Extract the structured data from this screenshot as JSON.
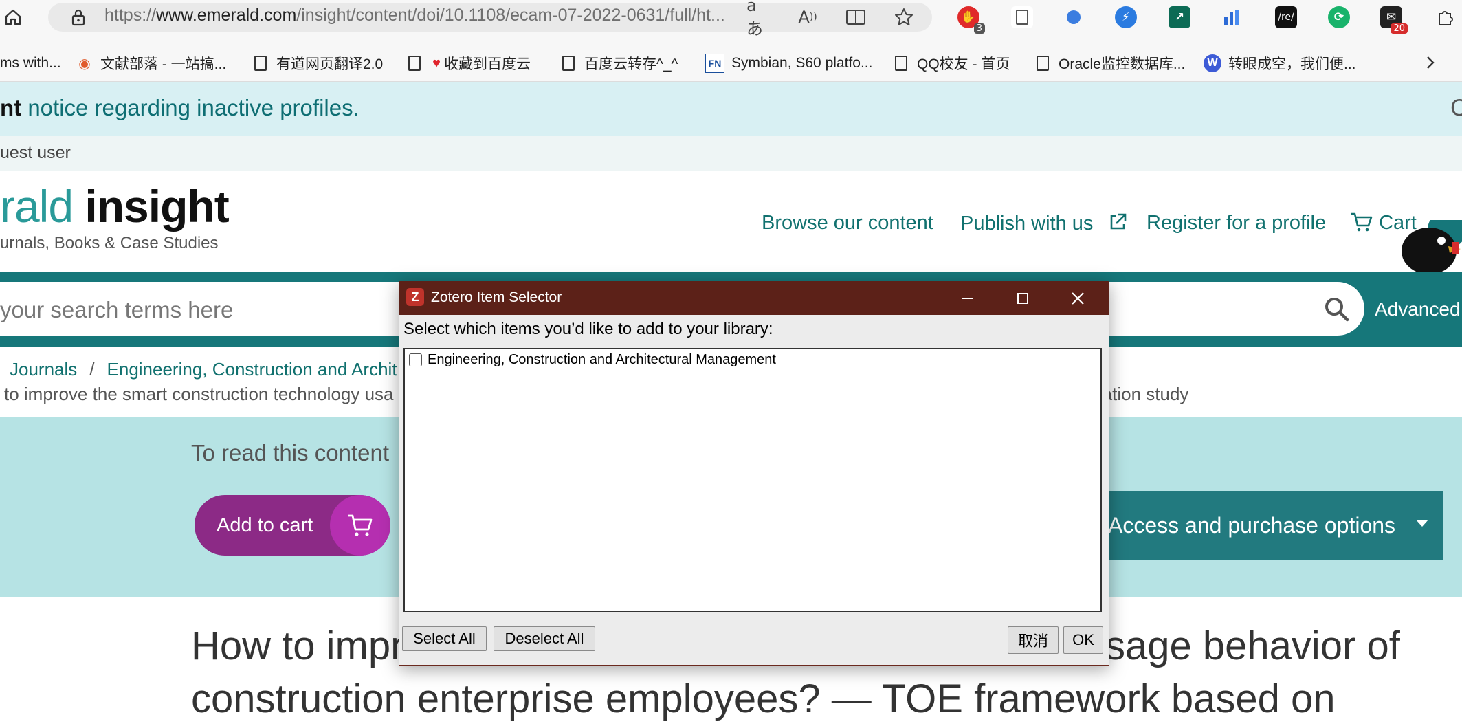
{
  "browser": {
    "url_prefix": "https://",
    "url_domain": "www.emerald.com",
    "url_path": "/insight/content/doi/10.1108/ecam-07-2022-0631/full/ht...",
    "extension_badges": {
      "red_ext": "3",
      "mail_ext": "20"
    },
    "ext_re_label": "/re/"
  },
  "bookmarks": [
    {
      "label": "ms with...",
      "icon": "none"
    },
    {
      "label": "文献部落 - 一站搞...",
      "icon": "spiral-icon"
    },
    {
      "label": "有道网页翻译2.0",
      "icon": "page-icon"
    },
    {
      "label": "收藏到百度云",
      "icon": "page-heart-icon"
    },
    {
      "label": "百度云转存^_^",
      "icon": "page-icon"
    },
    {
      "label": "Symbian, S60 platfo...",
      "icon": "fn-icon",
      "icon_text": "FN"
    },
    {
      "label": "QQ校友 - 首页",
      "icon": "page-icon"
    },
    {
      "label": "Oracle监控数据库...",
      "icon": "page-icon"
    },
    {
      "label": "转眼成空，我们便...",
      "icon": "wordpress-icon"
    }
  ],
  "notice": {
    "bold": "nt",
    "text": " notice regarding inactive profiles.",
    "close": "C"
  },
  "user": {
    "text": "uest user"
  },
  "logo": {
    "part1": "rald",
    "part2": " insight",
    "subtitle": "urnals, Books & Case Studies"
  },
  "nav": {
    "browse": "Browse our content",
    "publish": "Publish with us",
    "register": "Register for a profile",
    "cart": "Cart"
  },
  "search": {
    "placeholder": "your search terms here",
    "advanced": "Advanced s"
  },
  "breadcrumb": {
    "journals": "Journals",
    "sep": "/",
    "journal": "Engineering, Construction and Archit",
    "title_left": "to improve the smart construction technology usa",
    "title_right": "ration study"
  },
  "access": {
    "read_text": "To read this content",
    "add_to_cart": "Add to cart",
    "access_options": "Access and purchase options"
  },
  "article": {
    "line1_left": "How to impr",
    "line1_right": "sage behavior of",
    "line2": "construction enterprise employees? — TOE framework based on"
  },
  "dialog": {
    "title": "Zotero Item Selector",
    "logo_letter": "Z",
    "prompt": "Select which items you’d like to add to your library:",
    "items": [
      {
        "label": "Engineering, Construction and Architectural Management",
        "checked": false
      }
    ],
    "select_all": "Select All",
    "deselect_all": "Deselect All",
    "cancel": "取消",
    "ok": "OK"
  },
  "colors": {
    "teal": "#11716f",
    "notice_bg": "#d8f0f3",
    "access_bg": "#b6e3e4",
    "cart_purple": "#8c2a86",
    "dialog_titlebar": "#5c2118"
  }
}
